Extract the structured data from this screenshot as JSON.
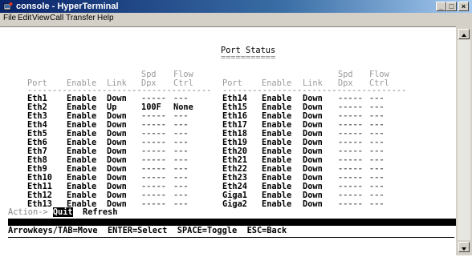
{
  "window": {
    "title": "console - HyperTerminal"
  },
  "menu": [
    "File",
    "Edit",
    "View",
    "Call",
    "Transfer",
    "Help"
  ],
  "terminal": {
    "heading": "Port Status",
    "heading_rule": "===========",
    "columns_top": {
      "spd": "Spd",
      "flow": "Flow"
    },
    "columns": {
      "port": "Port",
      "enable": "Enable",
      "link": "Link",
      "dpx": "Dpx",
      "ctrl": "Ctrl"
    },
    "rule": "-------------------------------------",
    "left_rows": [
      {
        "port": "Eth1",
        "enable": "Enable",
        "link": "Down",
        "spd": "-----",
        "flow": "---"
      },
      {
        "port": "Eth2",
        "enable": "Enable",
        "link": "Up",
        "spd": "100F",
        "flow": "None"
      },
      {
        "port": "Eth3",
        "enable": "Enable",
        "link": "Down",
        "spd": "-----",
        "flow": "---"
      },
      {
        "port": "Eth4",
        "enable": "Enable",
        "link": "Down",
        "spd": "-----",
        "flow": "---"
      },
      {
        "port": "Eth5",
        "enable": "Enable",
        "link": "Down",
        "spd": "-----",
        "flow": "---"
      },
      {
        "port": "Eth6",
        "enable": "Enable",
        "link": "Down",
        "spd": "-----",
        "flow": "---"
      },
      {
        "port": "Eth7",
        "enable": "Enable",
        "link": "Down",
        "spd": "-----",
        "flow": "---"
      },
      {
        "port": "Eth8",
        "enable": "Enable",
        "link": "Down",
        "spd": "-----",
        "flow": "---"
      },
      {
        "port": "Eth9",
        "enable": "Enable",
        "link": "Down",
        "spd": "-----",
        "flow": "---"
      },
      {
        "port": "Eth10",
        "enable": "Enable",
        "link": "Down",
        "spd": "-----",
        "flow": "---"
      },
      {
        "port": "Eth11",
        "enable": "Enable",
        "link": "Down",
        "spd": "-----",
        "flow": "---"
      },
      {
        "port": "Eth12",
        "enable": "Enable",
        "link": "Down",
        "spd": "-----",
        "flow": "---"
      },
      {
        "port": "Eth13",
        "enable": "Enable",
        "link": "Down",
        "spd": "-----",
        "flow": "---"
      }
    ],
    "right_rows": [
      {
        "port": "Eth14",
        "enable": "Enable",
        "link": "Down",
        "spd": "-----",
        "flow": "---"
      },
      {
        "port": "Eth15",
        "enable": "Enable",
        "link": "Down",
        "spd": "-----",
        "flow": "---"
      },
      {
        "port": "Eth16",
        "enable": "Enable",
        "link": "Down",
        "spd": "-----",
        "flow": "---"
      },
      {
        "port": "Eth17",
        "enable": "Enable",
        "link": "Down",
        "spd": "-----",
        "flow": "---"
      },
      {
        "port": "Eth18",
        "enable": "Enable",
        "link": "Down",
        "spd": "-----",
        "flow": "---"
      },
      {
        "port": "Eth19",
        "enable": "Enable",
        "link": "Down",
        "spd": "-----",
        "flow": "---"
      },
      {
        "port": "Eth20",
        "enable": "Enable",
        "link": "Down",
        "spd": "-----",
        "flow": "---"
      },
      {
        "port": "Eth21",
        "enable": "Enable",
        "link": "Down",
        "spd": "-----",
        "flow": "---"
      },
      {
        "port": "Eth22",
        "enable": "Enable",
        "link": "Down",
        "spd": "-----",
        "flow": "---"
      },
      {
        "port": "Eth23",
        "enable": "Enable",
        "link": "Down",
        "spd": "-----",
        "flow": "---"
      },
      {
        "port": "Eth24",
        "enable": "Enable",
        "link": "Down",
        "spd": "-----",
        "flow": "---"
      },
      {
        "port": "Giga1",
        "enable": "Enable",
        "link": "Down",
        "spd": "-----",
        "flow": "---"
      },
      {
        "port": "Giga2",
        "enable": "Enable",
        "link": "Down",
        "spd": "-----",
        "flow": "---"
      }
    ],
    "action": {
      "prompt": "Action->",
      "quit": "Quit",
      "refresh": "Refresh"
    },
    "help": "Arrowkeys/TAB=Move  ENTER=Select  SPACE=Toggle  ESC=Back"
  },
  "icons": {
    "app": "hyperterminal-icon",
    "minimize": "minimize-icon",
    "maximize": "maximize-icon",
    "close": "close-icon"
  },
  "colors": {
    "titlebar": "#0a246a",
    "chrome": "#d4d0c8",
    "terminal_bg": "#ffffff",
    "highlight": "#000000"
  }
}
